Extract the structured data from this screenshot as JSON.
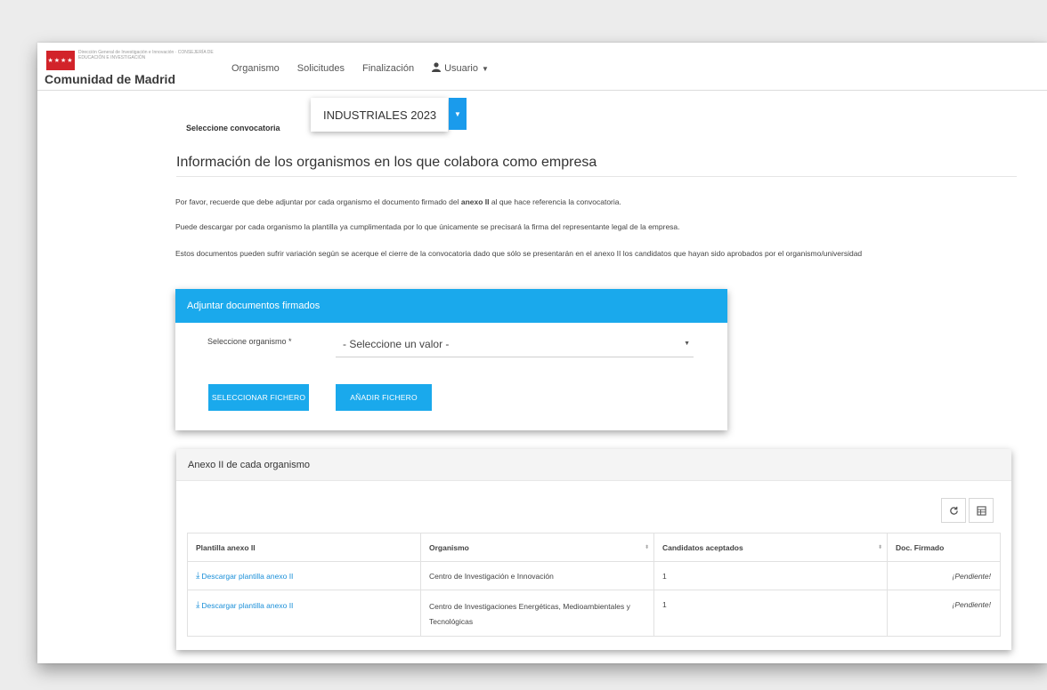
{
  "header": {
    "logo_small_text": "Dirección General de Investigación e Innovación · CONSEJERÍA DE EDUCACIÓN E INVESTIGACIÓN",
    "brand": "Comunidad de Madrid",
    "nav": [
      {
        "label": "Organismo"
      },
      {
        "label": "Solicitudes"
      },
      {
        "label": "Finalización"
      },
      {
        "label": "Usuario"
      }
    ]
  },
  "convocatoria": {
    "label": "Seleccione convocatoria",
    "value": "INDUSTRIALES 2023"
  },
  "section": {
    "title": "Información de los organismos en los que colabora como empresa",
    "p1_before": "Por favor, recuerde que debe adjuntar por cada organismo el documento firmado del ",
    "p1_bold": "anexo II",
    "p1_after": " al que hace referencia la convocatoria.",
    "p2": "Puede descargar por cada organismo la plantilla ya cumplimentada por lo que únicamente se precisará la firma del representante legal de la empresa.",
    "p3": "Estos documentos pueden sufrir variación según se acerque el cierre de la convocatoria dado que sólo se presentarán en el anexo II los candidatos que hayan sido aprobados por el organismo/universidad"
  },
  "upload": {
    "header": "Adjuntar documentos firmados",
    "org_label": "Seleccione organismo *",
    "org_value": "- Seleccione un valor -",
    "btn_select": "SELECCIONAR FICHERO",
    "btn_add": "AÑADIR FICHERO"
  },
  "anexo": {
    "header": "Anexo II de cada organismo",
    "columns": [
      "Plantilla anexo II",
      "Organismo",
      "Candidatos aceptados",
      "Doc. Firmado"
    ],
    "rows": [
      {
        "link": "Descargar plantilla anexo II",
        "organismo": "Centro de Investigación e Innovación",
        "candidatos": "1",
        "estado": "¡Pendiente!"
      },
      {
        "link": "Descargar plantilla anexo II",
        "organismo": "Centro de Investigaciones Energéticas, Medioambientales y Tecnológicas",
        "candidatos": "1",
        "estado": "¡Pendiente!"
      }
    ]
  },
  "icons": {
    "user": "user-icon",
    "refresh": "refresh-icon",
    "columns": "columns-icon",
    "download": "download-icon"
  },
  "colors": {
    "accent": "#1aa9ec",
    "brand_red": "#d2232a"
  }
}
